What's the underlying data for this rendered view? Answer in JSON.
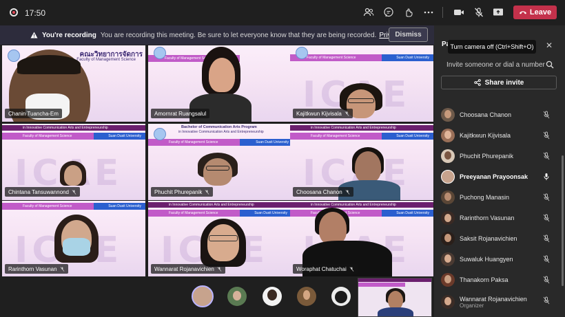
{
  "topbar": {
    "time": "17:50",
    "leave_label": "Leave"
  },
  "banner": {
    "title": "You're recording",
    "message": "You are recording this meeting. Be sure to let everyone know that they are being recorded.",
    "link": "Privacy policy",
    "dismiss_label": "Dismiss"
  },
  "tooltip": "Turn camera off (Ctrl+Shift+O)",
  "panel": {
    "title": "Pa",
    "invite_placeholder": "Invite someone or dial a number",
    "share_label": "Share invite",
    "participants": [
      {
        "name": "Choosana Chanon",
        "role": ""
      },
      {
        "name": "Kajitkwun Kijvisala",
        "role": ""
      },
      {
        "name": "Phuchit Phurepanik",
        "role": ""
      },
      {
        "name": "Preeyanan Prayoonsak",
        "role": ""
      },
      {
        "name": "Puchong Manasin",
        "role": ""
      },
      {
        "name": "Rarinthorn Vasunan",
        "role": ""
      },
      {
        "name": "Saksit Rojanavichien",
        "role": ""
      },
      {
        "name": "Suwaluk Huangyen",
        "role": ""
      },
      {
        "name": "Thanakorn Paksa",
        "role": ""
      },
      {
        "name": "Wannarat Rojanavichien",
        "role": "Organizer"
      }
    ]
  },
  "tiles": [
    {
      "name": "Chanin Tuancha-Em",
      "header": "คณะวิทยาการจัดการ",
      "header2": "Faculty of Management Science"
    },
    {
      "name": "Amornrat Ruangsalul",
      "header": "",
      "header2": ""
    },
    {
      "name": "Kajitkwun Kijvisala",
      "header": "",
      "header2": ""
    },
    {
      "name": "Chintana Tansuwannond",
      "header": "",
      "header2": ""
    },
    {
      "name": "Phuchit Phurepanik",
      "header": "Bachelor of Communication Arts Program",
      "header2": "in Innovative Communication Arts and Entrepreneurship"
    },
    {
      "name": "Choosana Chanon",
      "header": "",
      "header2": ""
    },
    {
      "name": "Rarinthorn Vasunan",
      "header": "",
      "header2": ""
    },
    {
      "name": "Wannarat Rojanavichien",
      "header": "",
      "header2": ""
    },
    {
      "name": "Woraphat Chatuchai",
      "header": "",
      "header2": ""
    }
  ],
  "slide": {
    "program": "in Innovative Communication Arts and Entrepreneurship",
    "faculty": "Faculty of Management Science",
    "university": "Suan Dusit University",
    "watermark": "ICAE"
  }
}
